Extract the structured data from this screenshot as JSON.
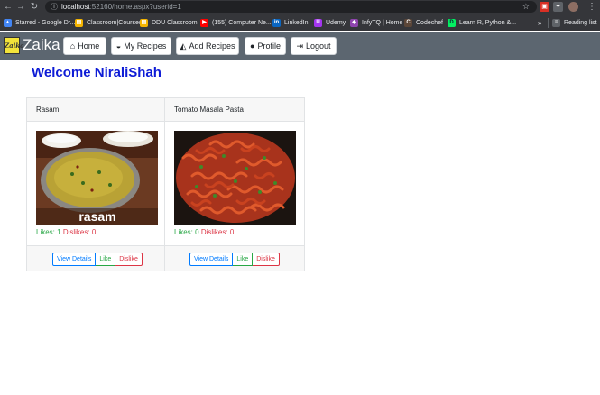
{
  "browser": {
    "url_host": "localhost",
    "url_rest": ":52160/home.aspx?userid=1",
    "bookmarks": [
      {
        "label": "Starred - Google Dr...",
        "icon": "google-drive-icon",
        "color": "#4285f4"
      },
      {
        "label": "Classroom|Courses",
        "icon": "classroom-icon",
        "color": "#f4b400"
      },
      {
        "label": "DDU Classroom",
        "icon": "classroom-icon",
        "color": "#f4b400"
      },
      {
        "label": "(155) Computer Ne...",
        "icon": "youtube-icon",
        "color": "#ff0000"
      },
      {
        "label": "LinkedIn",
        "icon": "linkedin-icon",
        "color": "#0a66c2"
      },
      {
        "label": "Udemy",
        "icon": "udemy-icon",
        "color": "#a435f0"
      },
      {
        "label": "InfyTQ | Home",
        "icon": "infytq-icon",
        "color": "#8e44ad"
      },
      {
        "label": "Codechef",
        "icon": "codechef-icon",
        "color": "#5b4638"
      },
      {
        "label": "Learn R, Python &...",
        "icon": "datacamp-icon",
        "color": "#03ef62"
      }
    ],
    "more_label": "»",
    "reading_list": "Reading list"
  },
  "navbar": {
    "logo_text": "Zaika",
    "brand": "Zaika",
    "buttons": [
      {
        "label": "Home",
        "icon": "home-icon"
      },
      {
        "label": "My Recipes",
        "icon": "recipes-icon"
      },
      {
        "label": "Add Recipes",
        "icon": "add-recipe-icon"
      },
      {
        "label": "Profile",
        "icon": "user-icon"
      },
      {
        "label": "Logout",
        "icon": "logout-icon"
      }
    ]
  },
  "welcome": "Welcome NiraliShah",
  "recipes": [
    {
      "title": "Rasam",
      "image_caption": "rasam",
      "likes_label": "Likes: 1",
      "dislikes_label": "Dislikes: 0"
    },
    {
      "title": "Tomato Masala Pasta",
      "likes_label": "Likes: 0",
      "dislikes_label": "Dislikes: 0"
    }
  ],
  "buttons": {
    "details": "View Details",
    "like": "Like",
    "dislike": "Dislike"
  },
  "colors": {
    "navbar": "#5c6670",
    "welcome": "#0d1bd6",
    "likes": "#28a745",
    "dislikes": "#dc3545",
    "details": "#007bff"
  }
}
